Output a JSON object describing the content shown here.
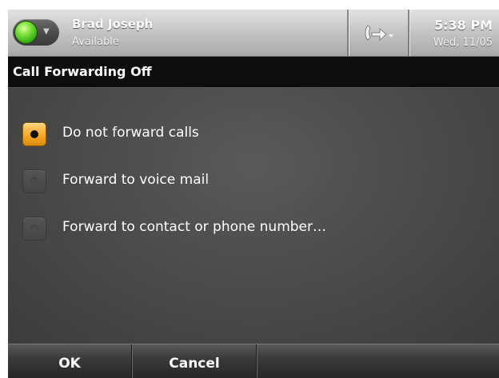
{
  "status_bar": {
    "user_name": "Brad Joseph",
    "presence": "Available",
    "presence_color": "#3cc41a",
    "forward_icon": "call-forward-icon",
    "time": "5:38 PM",
    "date": "Wed, 11/05"
  },
  "page": {
    "title": "Call Forwarding Off"
  },
  "options": [
    {
      "label": "Do not forward calls",
      "selected": true
    },
    {
      "label": "Forward to voice mail",
      "selected": false
    },
    {
      "label": "Forward to contact or phone number…",
      "selected": false
    }
  ],
  "softkeys": {
    "ok_label": "OK",
    "cancel_label": "Cancel"
  },
  "colors": {
    "selected_radio": "#f5a623",
    "title_bar": "#0d0d0d"
  }
}
